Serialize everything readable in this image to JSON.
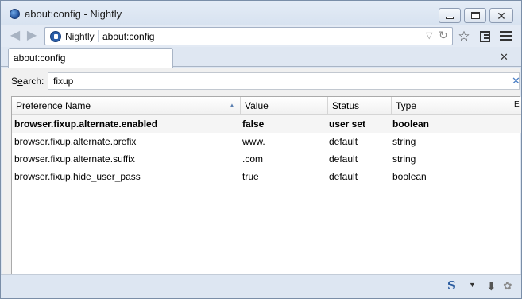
{
  "window": {
    "title": "about:config - Nightly"
  },
  "navbar": {
    "back_icon": "back-arrow-icon",
    "forward_icon": "forward-arrow-icon",
    "identity_label": "Nightly",
    "url": "about:config"
  },
  "tabs": [
    {
      "label": "about:config"
    }
  ],
  "search": {
    "label_prefix": "S",
    "label_accel": "e",
    "label_suffix": "arch:",
    "value": "fixup"
  },
  "table": {
    "columns": [
      "Preference Name",
      "Value",
      "Status",
      "Type",
      "E"
    ],
    "rows": [
      {
        "name": "browser.fixup.alternate.enabled",
        "value": "false",
        "status": "user set",
        "type": "boolean",
        "modified": true
      },
      {
        "name": "browser.fixup.alternate.prefix",
        "value": "www.",
        "status": "default",
        "type": "string",
        "modified": false
      },
      {
        "name": "browser.fixup.alternate.suffix",
        "value": ".com",
        "status": "default",
        "type": "string",
        "modified": false
      },
      {
        "name": "browser.fixup.hide_user_pass",
        "value": "true",
        "status": "default",
        "type": "boolean",
        "modified": false
      }
    ]
  },
  "statusbar": {
    "addon_s_label": "S"
  },
  "colors": {
    "accent": "#2b5ea8",
    "chrome_bg": "#dde6f2"
  }
}
